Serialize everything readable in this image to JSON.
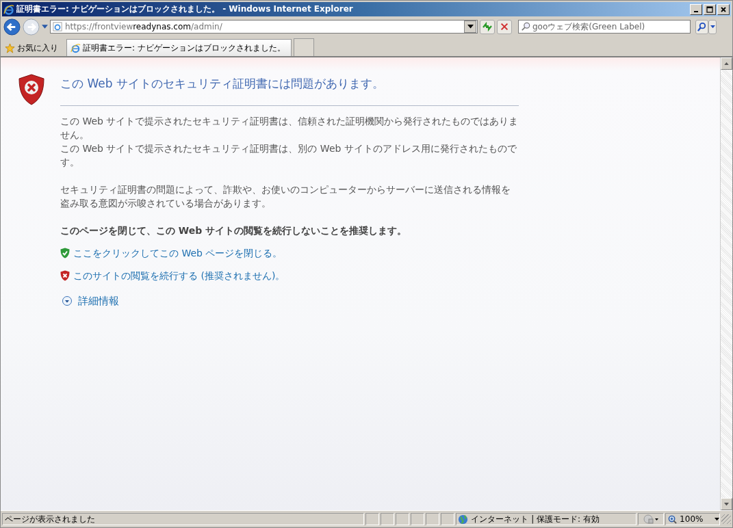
{
  "window": {
    "title": "証明書エラー: ナビゲーションはブロックされました。 - Windows Internet Explorer"
  },
  "address": {
    "url_prefix": "https://frontview",
    "url_domain": "readynas.com",
    "url_path": "/admin/"
  },
  "search": {
    "placeholder": "gooウェブ検索(Green Label)"
  },
  "favorites": {
    "label": "お気に入り"
  },
  "tabs": [
    {
      "title": "証明書エラー: ナビゲーションはブロックされました。",
      "selected": true
    }
  ],
  "page": {
    "heading": "この Web サイトのセキュリティ証明書には問題があります。",
    "paragraphs": [
      [
        "この Web サイトで提示されたセキュリティ証明書は、信頼された証明機関から発行されたものではありません。",
        "この Web サイトで提示されたセキュリティ証明書は、別の Web サイトのアドレス用に発行されたものです。"
      ],
      [
        "セキュリティ証明書の問題によって、詐欺や、お使いのコンピューターからサーバーに送信される情報を盗み取る意図が示唆されている場合があります。"
      ]
    ],
    "recommendation": "このページを閉じて、この Web サイトの閲覧を続行しないことを推奨します。",
    "links": [
      {
        "kind": "safe",
        "text": "ここをクリックしてこの Web ページを閉じる。"
      },
      {
        "kind": "unsafe",
        "text": "このサイトの閲覧を続行する (推奨されません)。"
      }
    ],
    "more_info": "詳細情報"
  },
  "status_bar": {
    "status": "ページが表示されました",
    "zone": "インターネット | 保護モード: 有効",
    "zoom": "100%"
  }
}
